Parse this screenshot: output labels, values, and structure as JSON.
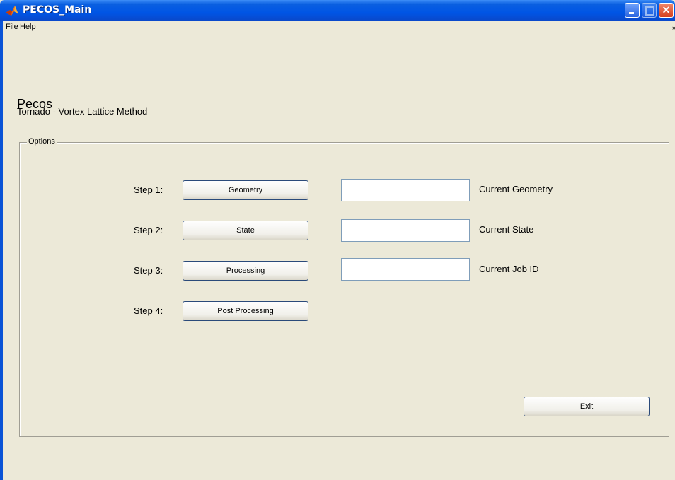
{
  "window": {
    "title": "PECOS_Main"
  },
  "menu": {
    "file": "File",
    "help": "Help",
    "overflow": "»"
  },
  "header": {
    "title": "Pecos",
    "subtitle": "Tornado - Vortex Lattice Method"
  },
  "options": {
    "label": "Options",
    "steps": [
      {
        "label": "Step 1:",
        "button": "Geometry",
        "field_value": "",
        "field_label": "Current Geometry"
      },
      {
        "label": "Step 2:",
        "button": "State",
        "field_value": "",
        "field_label": "Current State"
      },
      {
        "label": "Step 3:",
        "button": "Processing",
        "field_value": "",
        "field_label": "Current Job ID"
      },
      {
        "label": "Step 4:",
        "button": "Post Processing"
      }
    ],
    "exit_label": "Exit"
  },
  "icons": {
    "app": "matlab-icon",
    "minimize": "minimize-icon",
    "maximize": "maximize-icon",
    "close": "close-icon"
  },
  "colors": {
    "titlebar": "#0055e5",
    "background": "#ece9d8",
    "close_button": "#d6401e"
  }
}
